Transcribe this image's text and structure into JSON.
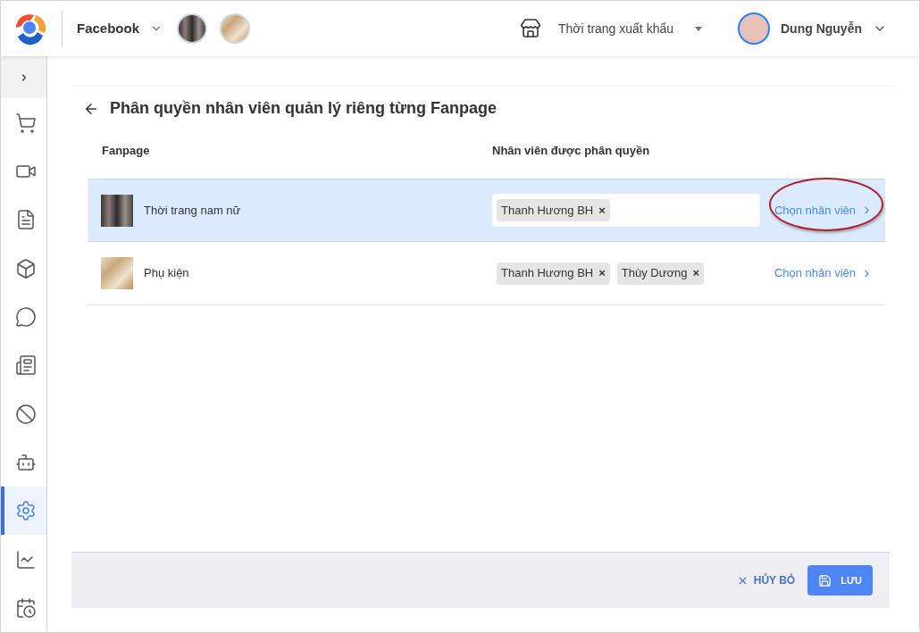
{
  "header": {
    "channel": "Facebook",
    "shop": "Thời trang xuất khẩu",
    "user": "Dung Nguyễn"
  },
  "sidebar": {
    "items": [
      {
        "kind": "cart",
        "selected": false
      },
      {
        "kind": "video",
        "selected": false
      },
      {
        "kind": "document",
        "selected": false
      },
      {
        "kind": "box",
        "selected": false
      },
      {
        "kind": "messenger",
        "selected": false
      },
      {
        "kind": "card",
        "selected": false
      },
      {
        "kind": "ban",
        "selected": false
      },
      {
        "kind": "bot",
        "selected": false
      },
      {
        "kind": "settings",
        "selected": true
      },
      {
        "kind": "chart",
        "selected": false
      },
      {
        "kind": "report",
        "selected": false
      }
    ]
  },
  "page": {
    "title": "Phân quyền nhân viên quản lý riêng từng Fanpage"
  },
  "table": {
    "columns": [
      "Fanpage",
      "Nhân viên được phân quyền"
    ],
    "rows": [
      {
        "name": "Thời trang nam nữ",
        "selected": true,
        "circled": true,
        "staff": [
          {
            "name": "Thanh Hương BH",
            "remove": "×"
          }
        ],
        "action": "Chọn nhân viên"
      },
      {
        "name": "Phụ kiện",
        "selected": false,
        "circled": false,
        "staff": [
          {
            "name": "Thanh Hương BH",
            "remove": "×"
          },
          {
            "name": "Thùy Dương",
            "remove": "×"
          }
        ],
        "action": "Chọn nhân viên"
      }
    ]
  },
  "footer": {
    "cancel": "HỦY BỎ",
    "save": "LƯU"
  }
}
